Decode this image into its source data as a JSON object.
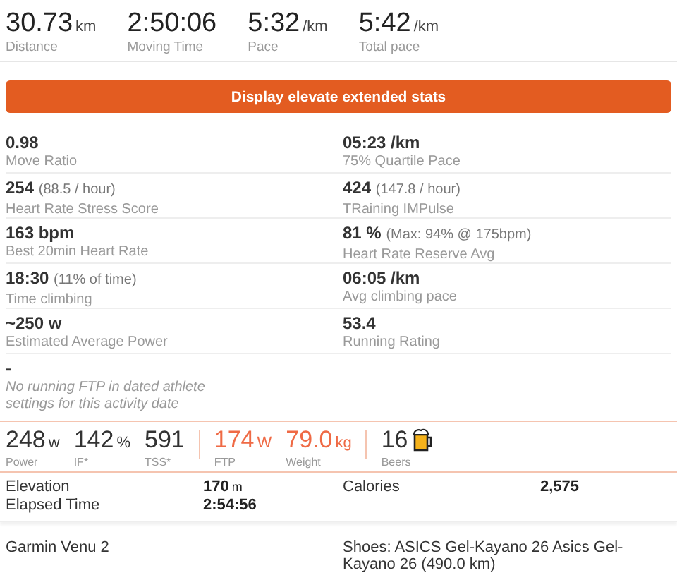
{
  "summary": [
    {
      "value": "30.73",
      "unit": "km",
      "label": "Distance"
    },
    {
      "value": "2:50:06",
      "label": "Moving Time"
    },
    {
      "value": "5:32",
      "unit": "/km",
      "label": "Pace"
    },
    {
      "value": "5:42",
      "unit": "/km",
      "label": "Total pace"
    }
  ],
  "extended_button": "Display elevate extended stats",
  "extended_stats": [
    {
      "kind": "stat",
      "value": "0.98",
      "label": "Move Ratio"
    },
    {
      "kind": "stat",
      "value": "05:23 /km",
      "label": "75% Quartile Pace"
    },
    {
      "kind": "stat",
      "value": "254",
      "note": "(88.5 / hour)",
      "label": "Heart Rate Stress Score"
    },
    {
      "kind": "stat",
      "value": "424",
      "note": "(147.8 / hour)",
      "label": "TRaining IMPulse"
    },
    {
      "kind": "stat",
      "value": "163 bpm",
      "label": "Best 20min Heart Rate"
    },
    {
      "kind": "stat",
      "value": "81 %",
      "note": "(Max: 94% @ 175bpm)",
      "label": "Heart Rate Reserve Avg"
    },
    {
      "kind": "stat",
      "value": "18:30",
      "note": "(11% of time)",
      "label": "Time climbing"
    },
    {
      "kind": "stat",
      "value": "06:05 /km",
      "label": "Avg climbing pace"
    },
    {
      "kind": "stat",
      "value": "~250 w",
      "label": "Estimated Average Power"
    },
    {
      "kind": "stat",
      "value": "53.4",
      "label": "Running Rating"
    },
    {
      "kind": "warning",
      "value": "-",
      "label": "No running FTP in dated athlete settings for this activity date"
    }
  ],
  "power_groups": [
    [
      {
        "value": "248",
        "unit": "w",
        "label": "Power",
        "highlighted": false
      },
      {
        "value": "142",
        "unit": "%",
        "label": "IF*",
        "highlighted": false
      },
      {
        "value": "591",
        "label": "TSS*",
        "highlighted": false
      }
    ],
    [
      {
        "value": "174",
        "unit": "W",
        "label": "FTP",
        "highlighted": true
      },
      {
        "value": "79.0",
        "unit": "kg",
        "label": "Weight",
        "highlighted": true
      }
    ]
  ],
  "beers": {
    "value": "16",
    "label": "Beers"
  },
  "details": [
    [
      {
        "label": "Elevation",
        "value": "170",
        "unit": "m"
      },
      {
        "label": "Elapsed Time",
        "value": "2:54:56"
      }
    ],
    [
      {
        "label": "Calories",
        "value": "2,575"
      }
    ]
  ],
  "footer": {
    "device": "Garmin Venu 2",
    "gear": "Shoes: ASICS Gel-Kayano 26 Asics Gel-Kayano 26 (490.0 km)"
  }
}
